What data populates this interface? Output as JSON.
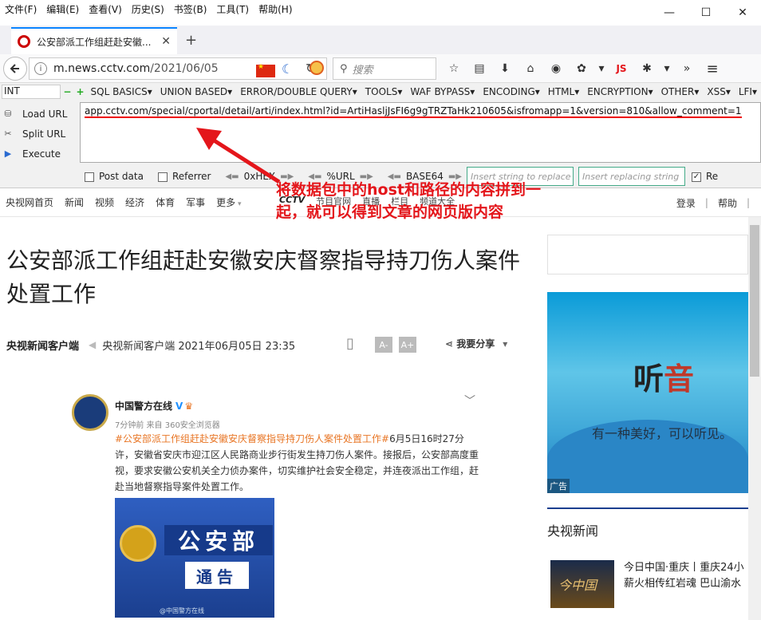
{
  "menubar": {
    "items": [
      "文件(F)",
      "编辑(E)",
      "查看(V)",
      "历史(S)",
      "书签(B)",
      "工具(T)",
      "帮助(H)"
    ]
  },
  "window": {
    "minimize": "—",
    "maximize": "☐",
    "close": "✕"
  },
  "tab": {
    "title": "公安部派工作组赶赴安徽...",
    "close": "✕",
    "new": "+"
  },
  "nav": {
    "url_host": "m.news.cctv.com",
    "url_path": "/2021/06/05",
    "search_placeholder": "搜索",
    "js_label": "JS"
  },
  "hackbar": {
    "select": "INT",
    "menu": [
      "SQL BASICS▾",
      "UNION BASED▾",
      "ERROR/DOUBLE QUERY▾",
      "TOOLS▾",
      "WAF BYPASS▾",
      "ENCODING▾",
      "HTML▾",
      "ENCRYPTION▾",
      "OTHER▾",
      "XSS▾",
      "LFI▾"
    ],
    "load_url": "Load URL",
    "split_url": "Split URL",
    "execute": "Execute",
    "url_value_host": "app.cctv.com",
    "url_value_rest": "/special/cportal/detail/arti/index.html?id=ArtiHasljJsFI6g9gTRZTaHk210605&isfromapp=1&version=810&allow_comment=1",
    "post_data": "Post data",
    "referrer": "Referrer",
    "enc1": "0xHEX",
    "enc2": "%URL",
    "enc3": "BASE64",
    "insert_placeholder": "Insert string to replace",
    "replace_placeholder": "Insert replacing string",
    "re_label": "Re"
  },
  "annotation": {
    "text": "将数据包中的host和路径的内容拼到一起，就可以得到文章的网页版内容"
  },
  "site": {
    "nav": [
      "央视网首页",
      "新闻",
      "视频",
      "经济",
      "体育",
      "军事",
      "更多"
    ],
    "login": "登录",
    "help": "帮助",
    "divider": "|",
    "cctv_bar": [
      "CCTV",
      "节目官网",
      "直播",
      "栏目",
      "频道大全"
    ]
  },
  "article": {
    "title": "公安部派工作组赶赴安徽安庆督察指导持刀伤人案件处置工作",
    "source": "央视新闻客户端",
    "source_meta": "央视新闻客户端 2021年06月05日 23:35",
    "font_small": "A-",
    "font_large": "A+",
    "share": "我要分享"
  },
  "post": {
    "account": "中国警方在线",
    "verified": "V",
    "time": "7分钟前 来自 360安全浏览器",
    "tag": "#公安部派工作组赶赴安徽安庆督察指导持刀伤人案件处置工作#",
    "body": "6月5日16时27分许，安徽省安庆市迎江区人民路商业步行街发生持刀伤人案件。接报后，公安部高度重视，要求安徽公安机关全力侦办案件，切实维护社会安全稳定，并连夜派出工作组，赶赴当地督察指导案件处置工作。",
    "img_line1": "公安部",
    "img_line2": "通告",
    "img_watermark": "@中国警方在线"
  },
  "sidebar": {
    "ad_logo_1": "听",
    "ad_logo_2": "音",
    "ad_slogan": "有一种美好，可以听见。",
    "ad_label": "广告",
    "section_title": "央视新闻",
    "news_thumb": "今中国",
    "news_line1": "今日中国·重庆丨重庆24小",
    "news_line2": "薪火相传红岩魂 巴山渝水"
  },
  "colors": {
    "annotation": "#e4161b",
    "accent": "#0a84ff",
    "link_tag": "#e87524"
  }
}
